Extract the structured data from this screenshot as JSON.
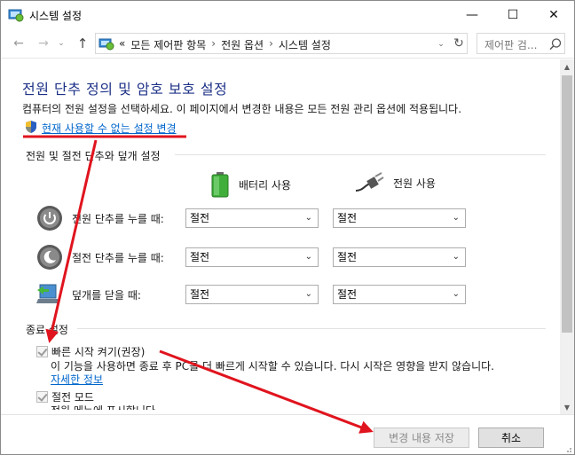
{
  "window": {
    "title": "시스템 설정",
    "minimize_glyph": "—",
    "maximize_glyph": "☐",
    "close_glyph": "✕"
  },
  "nav": {
    "back_glyph": "←",
    "forward_glyph": "→",
    "recent_glyph": "⌄",
    "up_glyph": "↑",
    "breadcrumb_prefix": "«",
    "breadcrumb": [
      "모든 제어판 항목",
      "전원 옵션",
      "시스템 설정"
    ],
    "breadcrumb_sep": "›",
    "dropdown_glyph": "⌄",
    "refresh_glyph": "↻",
    "search_placeholder": "제어판 검..."
  },
  "content": {
    "heading": "전원 단추 정의 및 암호 보호 설정",
    "description": "컴퓨터의 전원 설정을 선택하세요. 이 페이지에서 변경한 내용은 모든 전원 관리 옵션에 적용됩니다.",
    "change_link": "현재 사용할 수 없는 설정 변경",
    "buttons_section_title": "전원 및 절전 단추와 덮개 설정",
    "col_battery": "배터리 사용",
    "col_plugged": "전원 사용",
    "rows": [
      {
        "label": "전원 단추를 누를 때:",
        "battery": "절전",
        "plugged": "절전"
      },
      {
        "label": "절전 단추를 누를 때:",
        "battery": "절전",
        "plugged": "절전"
      },
      {
        "label": "덮개를 닫을 때:",
        "battery": "절전",
        "plugged": "절전"
      }
    ],
    "shutdown_section_title": "종료 설정",
    "fast_startup": {
      "label": "빠른 시작 켜기(권장)",
      "checked": true
    },
    "fast_startup_desc": "이 기능을 사용하면 종료 후 PC를 더 빠르게 시작할 수 있습니다. 다시 시작은 영향을 받지 않습니다.",
    "more_info": "자세한 정보",
    "sleep": {
      "label": "절전 모드",
      "checked": true
    },
    "sleep_desc_cut": "전원 메뉴에 표시합니다."
  },
  "footer": {
    "save_label": "변경 내용 저장",
    "cancel_label": "취소"
  },
  "colors": {
    "heading": "#1e3287",
    "link": "#0066cc",
    "annotation": "#e0141e"
  },
  "icons": {
    "app": "control-panel-icon",
    "shield": "uac-shield-icon",
    "battery": "battery-icon",
    "plug": "power-plug-icon",
    "power_button": "power-button-icon",
    "sleep_button": "sleep-button-icon",
    "lid": "laptop-lid-icon"
  }
}
